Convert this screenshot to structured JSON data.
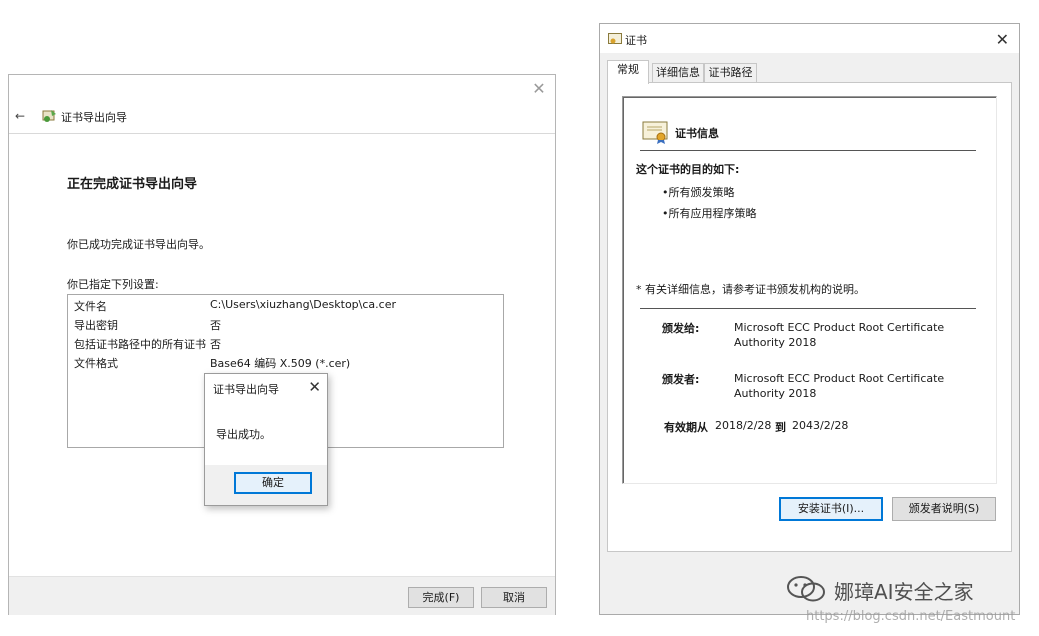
{
  "wizard": {
    "back": "←",
    "title": "证书导出向导",
    "heading": "正在完成证书导出向导",
    "success": "你已成功完成证书导出向导。",
    "settings_label": "你已指定下列设置:",
    "settings": [
      {
        "key": "文件名",
        "value": "C:\\Users\\xiuzhang\\Desktop\\ca.cer"
      },
      {
        "key": "导出密钥",
        "value": "否"
      },
      {
        "key": "包括证书路径中的所有证书",
        "value": "否"
      },
      {
        "key": "文件格式",
        "value": "Base64 编码 X.509 (*.cer)"
      }
    ],
    "finish_label": "完成(F)",
    "cancel_label": "取消"
  },
  "msgbox": {
    "title": "证书导出向导",
    "text": "导出成功。",
    "ok_label": "确定"
  },
  "cert": {
    "title": "证书",
    "tabs": [
      "常规",
      "详细信息",
      "证书路径"
    ],
    "info_title": "证书信息",
    "purpose_heading": "这个证书的目的如下:",
    "purposes": [
      "•所有颁发策略",
      "•所有应用程序策略"
    ],
    "note": "* 有关详细信息，请参考证书颁发机构的说明。",
    "issued_to_label": "颁发给:",
    "issued_to": "Microsoft ECC Product Root Certificate Authority 2018",
    "issued_by_label": "颁发者:",
    "issued_by": "Microsoft ECC Product Root Certificate Authority 2018",
    "valid_from_label": "有效期从",
    "valid_from": "2018/2/28",
    "valid_to_label": "到",
    "valid_to": "2043/2/28",
    "install_label": "安装证书(I)...",
    "statement_label": "颁发者说明(S)"
  },
  "watermark": {
    "text": "娜璋AI安全之家",
    "url": "https://blog.csdn.net/Eastmount"
  },
  "colors": {
    "focus_blue": "#0078d7",
    "button_face": "#e1e1e1",
    "dialog_bg": "#f0f0f0"
  }
}
